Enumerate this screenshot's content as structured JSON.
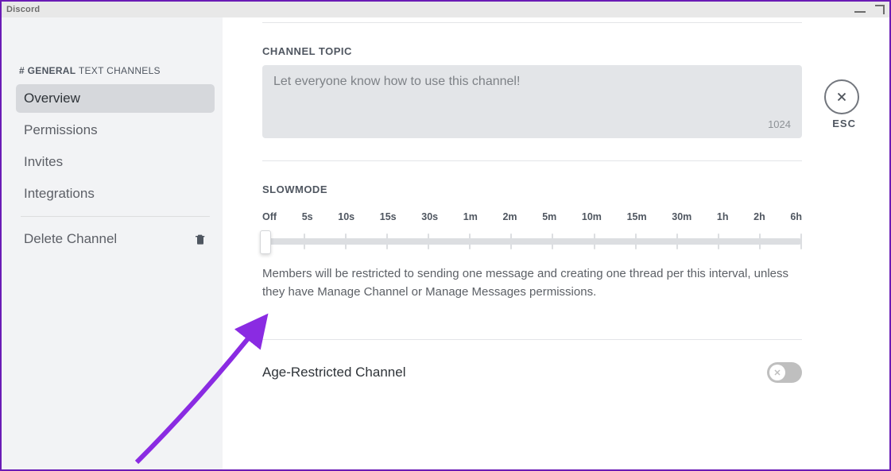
{
  "titlebar": {
    "title": "Discord"
  },
  "sidebar": {
    "heading_hash": "#",
    "heading_channel": "GENERAL",
    "heading_category": "TEXT CHANNELS",
    "items": [
      {
        "label": "Overview",
        "active": true
      },
      {
        "label": "Permissions",
        "active": false
      },
      {
        "label": "Invites",
        "active": false
      },
      {
        "label": "Integrations",
        "active": false
      }
    ],
    "delete_label": "Delete Channel"
  },
  "close": {
    "esc_label": "ESC"
  },
  "channel_topic": {
    "label": "CHANNEL TOPIC",
    "placeholder": "Let everyone know how to use this channel!",
    "char_limit": "1024"
  },
  "slowmode": {
    "label": "SLOWMODE",
    "ticks": [
      "Off",
      "5s",
      "10s",
      "15s",
      "30s",
      "1m",
      "2m",
      "5m",
      "10m",
      "15m",
      "30m",
      "1h",
      "2h",
      "6h"
    ],
    "help": "Members will be restricted to sending one message and creating one thread per this interval, unless they have Manage Channel or Manage Messages permissions."
  },
  "age_restricted": {
    "label": "Age-Restricted Channel",
    "value": false
  },
  "annotation": {
    "arrow_color": "#8a2be2"
  }
}
